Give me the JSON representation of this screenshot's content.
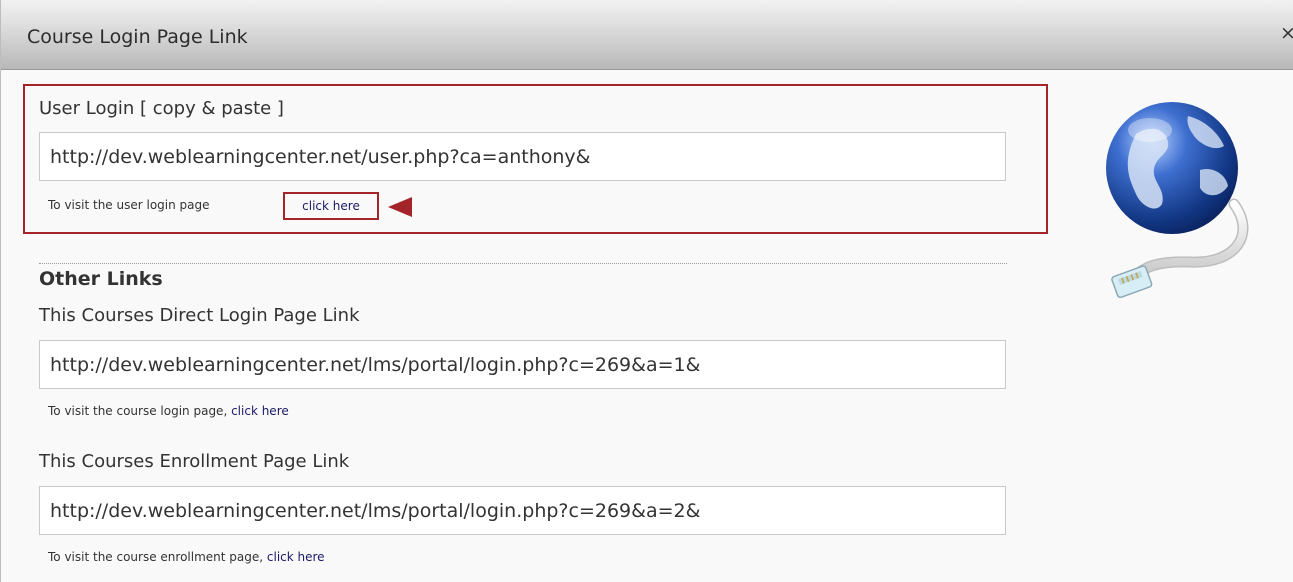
{
  "dialog": {
    "title": "Course Login Page Link",
    "close_label": "×"
  },
  "user_login": {
    "label": "User Login [ copy & paste ]",
    "url": "http://dev.weblearningcenter.net/user.php?ca=anthony&",
    "hint_text": "To visit the user login page",
    "link_text": "click here"
  },
  "other_links": {
    "heading": "Other Links",
    "direct_login": {
      "label": "This Courses Direct Login Page Link",
      "url": "http://dev.weblearningcenter.net/lms/portal/login.php?c=269&a=1&",
      "hint_text": "To visit the course login page, ",
      "link_text": "click here"
    },
    "enrollment": {
      "label": "This Courses Enrollment Page Link",
      "url": "http://dev.weblearningcenter.net/lms/portal/login.php?c=269&a=2&",
      "hint_text": "To visit the course enrollment page, ",
      "link_text": "click here"
    }
  },
  "colors": {
    "highlight": "#a3252a",
    "link": "#1a1a66",
    "globe": "#1f4aa8"
  },
  "icons": {
    "globe": "globe-network-icon",
    "arrow": "annotation-arrow-icon"
  }
}
